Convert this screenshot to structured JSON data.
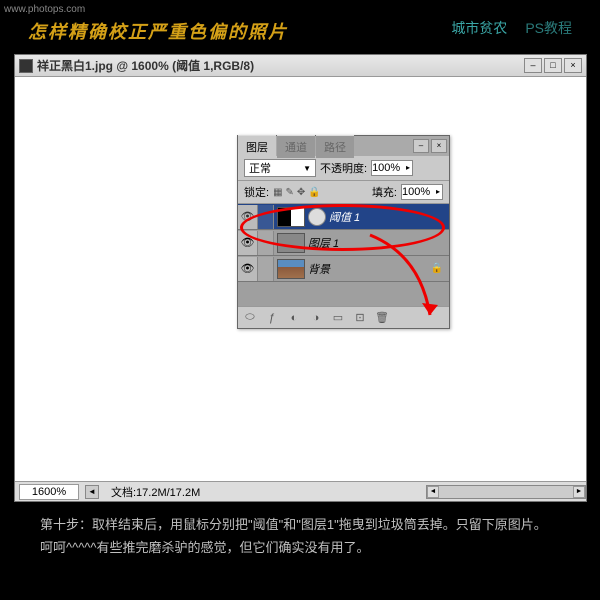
{
  "watermark": "www.photops.com",
  "header": {
    "title": "怎样精确校正严重色偏的照片",
    "link1": "城市贫农",
    "link2": "PS教程"
  },
  "window": {
    "title": "祥正黑白1.jpg @ 1600% (阈值 1,RGB/8)"
  },
  "status": {
    "zoom": "1600%",
    "docinfo": "文档:17.2M/17.2M"
  },
  "layers": {
    "tab_layers": "图层",
    "tab_channels": "通道",
    "tab_paths": "路径",
    "blend": "正常",
    "opacity_label": "不透明度:",
    "opacity_val": "100%",
    "lock_label": "锁定:",
    "fill_label": "填充:",
    "fill_val": "100%",
    "items": [
      {
        "name": "阈值 1"
      },
      {
        "name": "图层 1"
      },
      {
        "name": "背景"
      }
    ]
  },
  "tutorial": {
    "p1": "第十步：取样结束后，用鼠标分别把\"阈值\"和\"图层1\"拖曳到垃圾筒丢掉。只留下原图片。",
    "p2": "呵呵^^^^^有些推完磨杀驴的感觉，但它们确实没有用了。"
  }
}
